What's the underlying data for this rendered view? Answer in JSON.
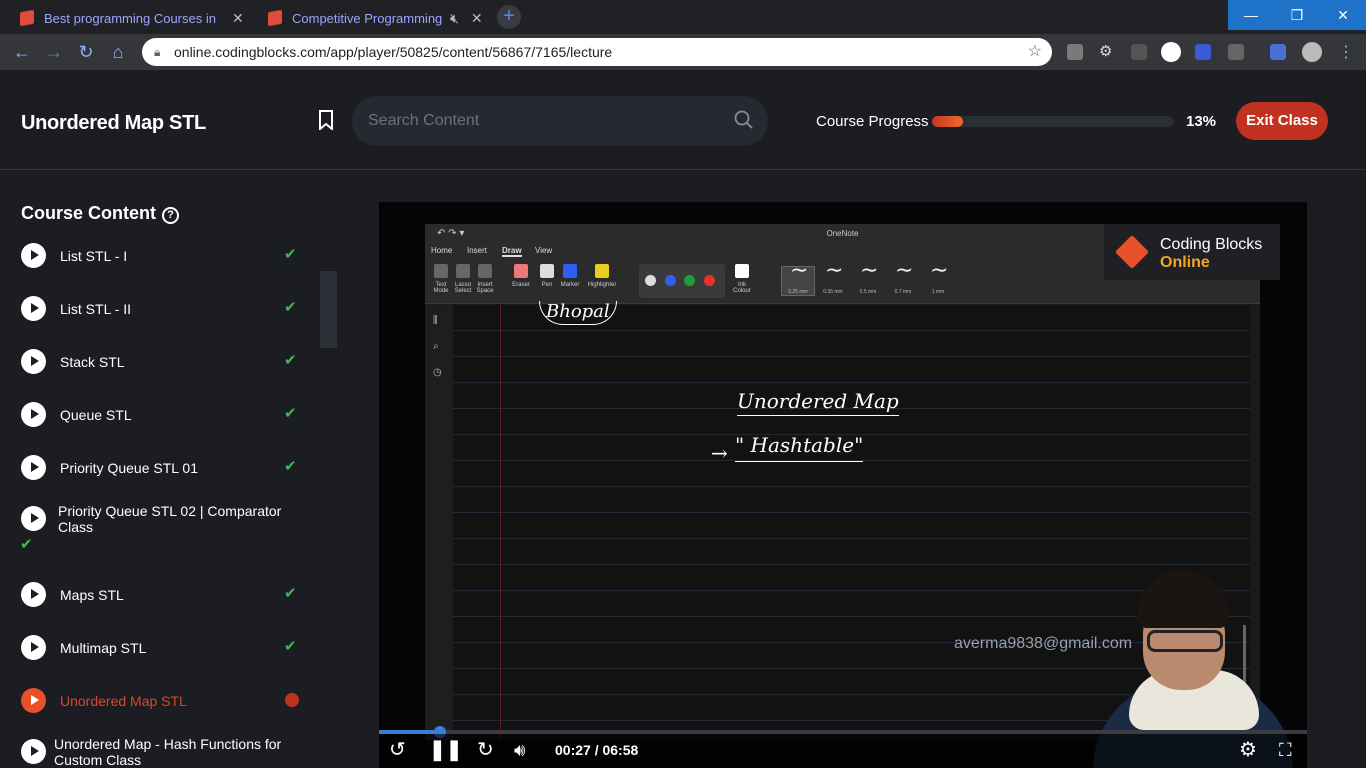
{
  "browser": {
    "tabs": [
      {
        "title": "Best programming Courses in De"
      },
      {
        "title": "Competitive Programming |"
      }
    ],
    "url": "online.codingblocks.com/app/player/50825/content/56867/7165/lecture",
    "new_tab_label": "+",
    "window": {
      "minimize": "—",
      "maximize": "❐",
      "close": "✕"
    }
  },
  "header": {
    "title": "Unordered Map STL",
    "search_placeholder": "Search Content",
    "progress_label": "Course Progress",
    "progress_percent": "13%",
    "progress_value": 0.13,
    "exit_label": "Exit Class"
  },
  "sidebar": {
    "title": "Course Content",
    "help": "?",
    "items": [
      {
        "label": "List STL - I",
        "status": "done"
      },
      {
        "label": "List STL - II",
        "status": "done"
      },
      {
        "label": "Stack STL",
        "status": "done"
      },
      {
        "label": "Queue STL",
        "status": "done"
      },
      {
        "label": "Priority Queue STL 01",
        "status": "done"
      },
      {
        "label": "Priority Queue STL 02 | Comparator Class",
        "status": "done"
      },
      {
        "label": "Maps STL",
        "status": "done"
      },
      {
        "label": "Multimap STL",
        "status": "done"
      },
      {
        "label": "Unordered Map STL",
        "status": "active"
      },
      {
        "label": "Unordered Map - Hash Functions for Custom Class",
        "status": "pending"
      }
    ],
    "check_glyph": "✔"
  },
  "video": {
    "onenote": {
      "app_title": "OneNote",
      "tabs": [
        "Home",
        "Insert",
        "Draw",
        "View"
      ],
      "selected_tab": "Draw",
      "tools": [
        "Text Mode",
        "Lasso Select",
        "Insert Space",
        "Eraser",
        "Pen",
        "Marker",
        "Highlighter",
        "Ink Colour"
      ],
      "pen_colors": [
        "#dddddd",
        "#2f5ff0",
        "#1e9e3a",
        "#e8322a"
      ],
      "stroke_sizes": [
        "0.25 mm",
        "0.35 mm",
        "0.5 mm",
        "0.7 mm",
        "1 mm"
      ],
      "handwriting": {
        "bhopal": "Bhopal",
        "title": "Unordered Map",
        "arrow": "→",
        "hashtable": "\" Hashtable\""
      }
    },
    "logo": {
      "line1": "Coding Blocks",
      "line2": "Online"
    },
    "watermark": "averma9838@gmail.com",
    "current_time": "00:27 / 06:58",
    "played_fraction": 0.065
  },
  "colors": {
    "accent": "#c0321f",
    "check": "#3fb950",
    "active": "#d8482a",
    "bg": "#1b1d23"
  }
}
